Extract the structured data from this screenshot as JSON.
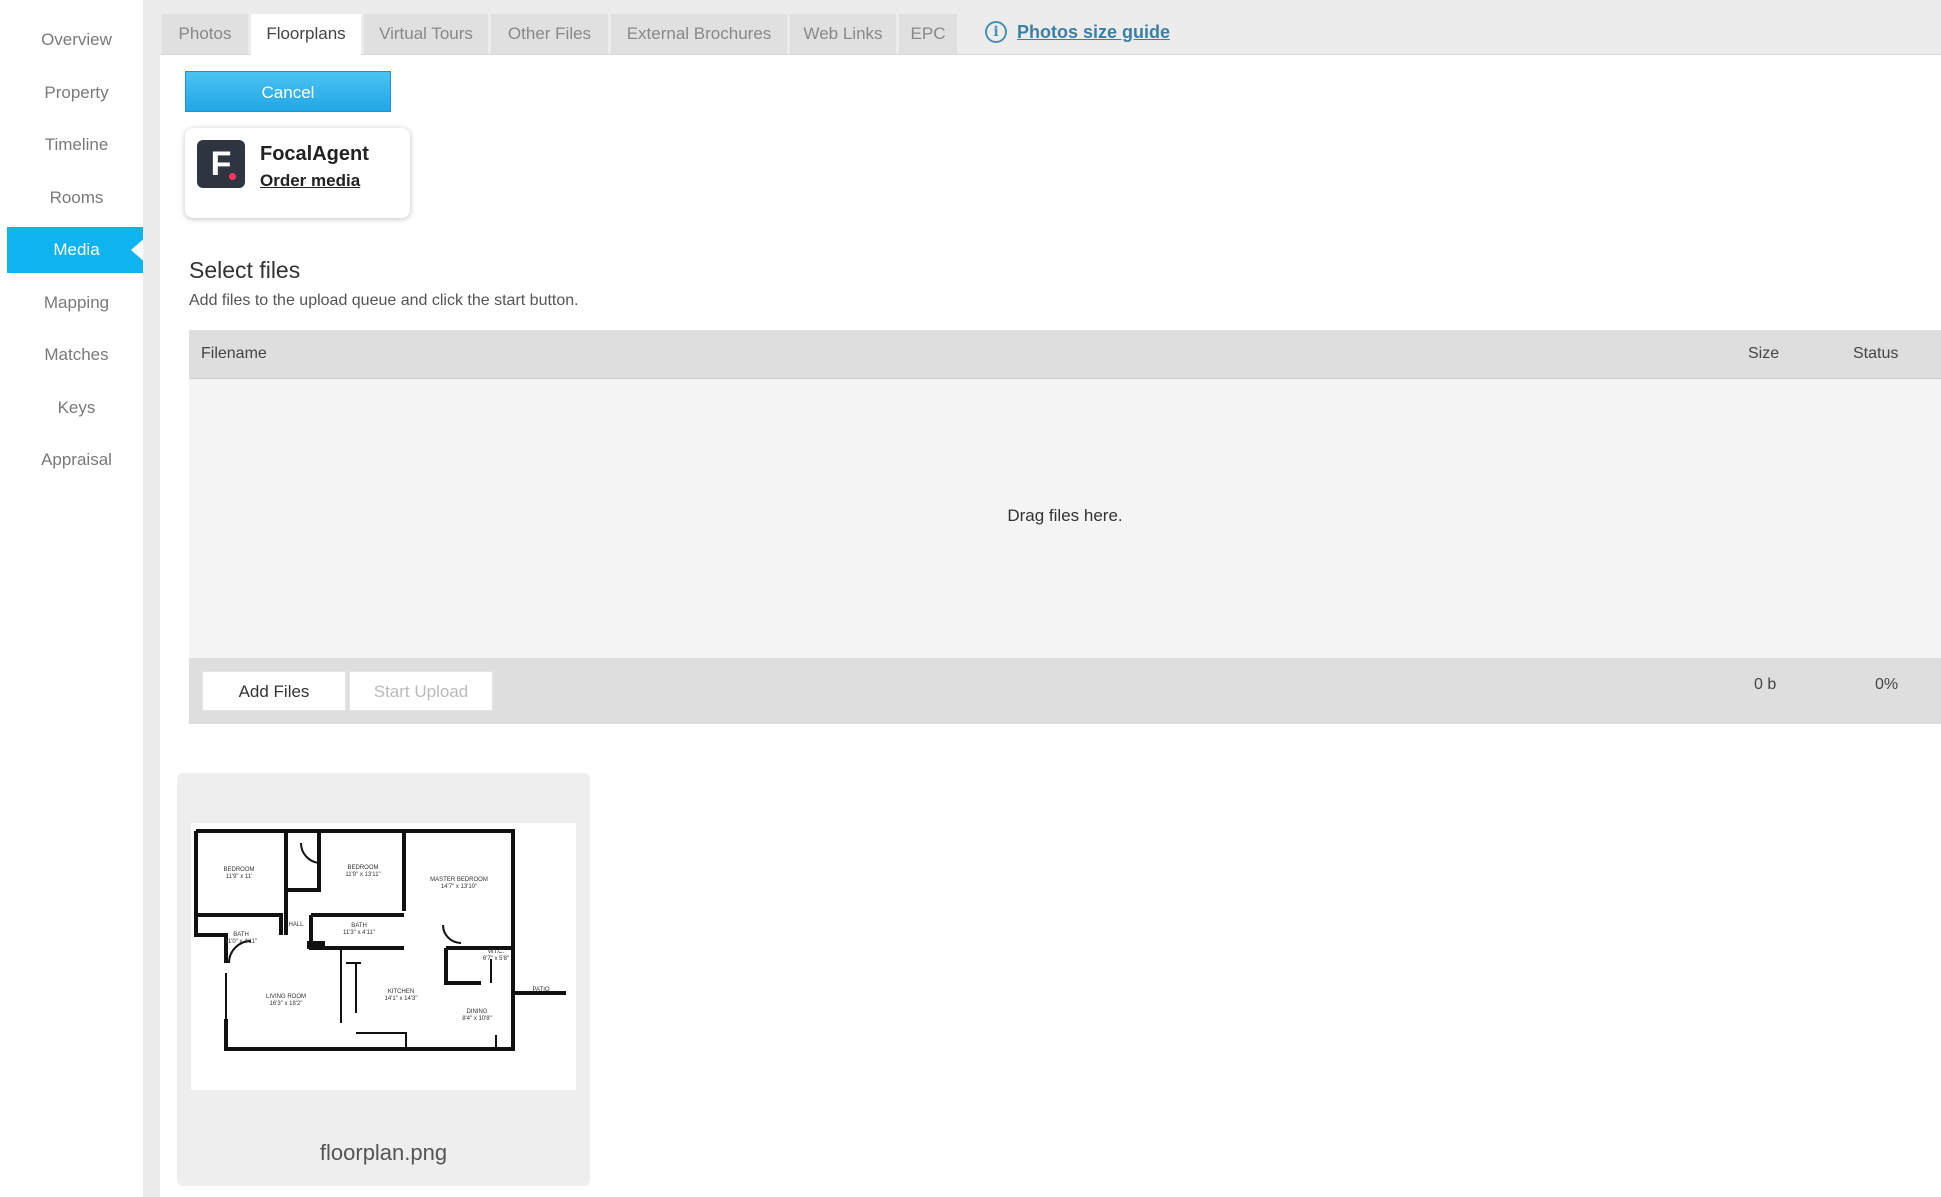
{
  "sidebar": {
    "items": [
      {
        "label": "Overview"
      },
      {
        "label": "Property"
      },
      {
        "label": "Timeline"
      },
      {
        "label": "Rooms"
      },
      {
        "label": "Media",
        "active": true
      },
      {
        "label": "Mapping"
      },
      {
        "label": "Matches"
      },
      {
        "label": "Keys"
      },
      {
        "label": "Appraisal"
      }
    ]
  },
  "tabs": [
    {
      "label": "Photos"
    },
    {
      "label": "Floorplans",
      "active": true
    },
    {
      "label": "Virtual Tours"
    },
    {
      "label": "Other Files"
    },
    {
      "label": "External Brochures"
    },
    {
      "label": "Web Links"
    },
    {
      "label": "EPC"
    }
  ],
  "guide": {
    "icon": "info-icon",
    "label": "Photos size guide"
  },
  "cancel_label": "Cancel",
  "focal": {
    "logo_letter": "F",
    "name": "FocalAgent",
    "order_label": "Order media"
  },
  "upload": {
    "title": "Select files",
    "description": "Add files to the upload queue and click the start button.",
    "columns": {
      "filename": "Filename",
      "size": "Size",
      "status": "Status"
    },
    "drop_text": "Drag files here.",
    "add_label": "Add Files",
    "start_label": "Start Upload",
    "total_size": "0 b",
    "total_percent": "0%"
  },
  "file": {
    "name": "floorplan.png"
  },
  "floorplan_labels": {
    "bed1": "BEDROOM",
    "bed1_dim": "11'9\" x 11'",
    "bed2": "BEDROOM",
    "bed2_dim": "11'9\" x 13'11\"",
    "master": "MASTER BEDROOM",
    "master_dim": "14'7\" x 13'10\"",
    "bath1": "BATH",
    "bath1_dim": "11'3\" x 4'11\"",
    "bath2": "BATH",
    "bath2_dim": "11'0\" x 4'11\"",
    "hall": "HALL",
    "wic": "W.I.C.",
    "wic_dim": "6'7\" x 5'8\"",
    "living": "LIVING ROOM",
    "living_dim": "16'3\" x 18'2\"",
    "kitchen": "KITCHEN",
    "kitchen_dim": "14'1\" x 14'3\"",
    "dining": "DINING",
    "dining_dim": "8'4\" x 10'8\"",
    "patio": "PATIO"
  }
}
